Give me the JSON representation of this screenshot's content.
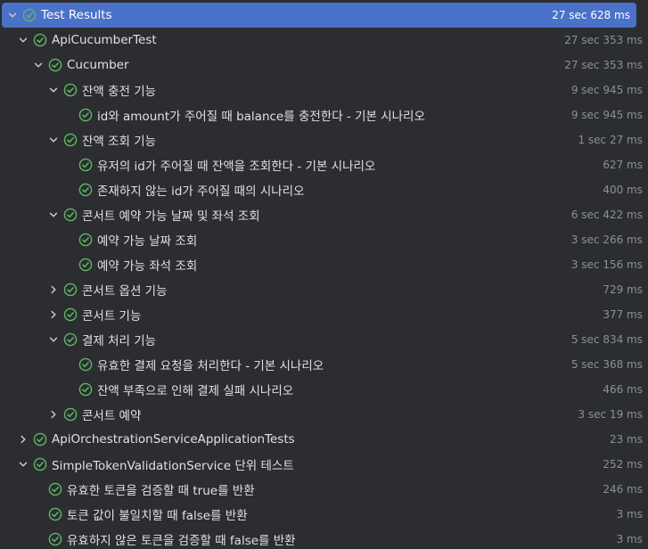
{
  "colors": {
    "background": "#2b2d30",
    "selected_row": "#4a72c8",
    "passed_icon": "#5fb865",
    "text": "#dfe1e5",
    "duration_text": "#8c9096"
  },
  "tree": {
    "rows": [
      {
        "name": "Test Results",
        "time": "27 sec 628 ms",
        "status": "passed",
        "expanded": true
      },
      {
        "name": "ApiCucumberTest",
        "time": "27 sec 353 ms",
        "status": "passed",
        "expanded": true
      },
      {
        "name": "Cucumber",
        "time": "27 sec 353 ms",
        "status": "passed",
        "expanded": true
      },
      {
        "name": "잔액 충전 기능",
        "time": "9 sec 945 ms",
        "status": "passed",
        "expanded": true
      },
      {
        "name": "id와 amount가 주어질 때 balance를 충전한다 - 기본 시나리오",
        "time": "9 sec 945 ms",
        "status": "passed"
      },
      {
        "name": "잔액 조회 기능",
        "time": "1 sec 27 ms",
        "status": "passed",
        "expanded": true
      },
      {
        "name": "유저의 id가 주어질 때 잔액을 조회한다 - 기본 시나리오",
        "time": "627 ms",
        "status": "passed"
      },
      {
        "name": "존재하지 않는 id가 주어질 때의 시나리오",
        "time": "400 ms",
        "status": "passed"
      },
      {
        "name": "콘서트 예약 가능 날짜 및 좌석 조회",
        "time": "6 sec 422 ms",
        "status": "passed",
        "expanded": true
      },
      {
        "name": "예약 가능 날짜 조회",
        "time": "3 sec 266 ms",
        "status": "passed"
      },
      {
        "name": "예약 가능 좌석 조회",
        "time": "3 sec 156 ms",
        "status": "passed"
      },
      {
        "name": "콘서트 옵션 기능",
        "time": "729 ms",
        "status": "passed",
        "expanded": false
      },
      {
        "name": "콘서트 기능",
        "time": "377 ms",
        "status": "passed",
        "expanded": false
      },
      {
        "name": "결제 처리 기능",
        "time": "5 sec 834 ms",
        "status": "passed",
        "expanded": true
      },
      {
        "name": "유효한 결제 요청을 처리한다 - 기본 시나리오",
        "time": "5 sec 368 ms",
        "status": "passed"
      },
      {
        "name": "잔액 부족으로 인해 결제 실패 시나리오",
        "time": "466 ms",
        "status": "passed"
      },
      {
        "name": "콘서트 예약",
        "time": "3 sec 19 ms",
        "status": "passed",
        "expanded": false
      },
      {
        "name": "ApiOrchestrationServiceApplicationTests",
        "time": "23 ms",
        "status": "passed",
        "expanded": false
      },
      {
        "name": "SimpleTokenValidationService 단위 테스트",
        "time": "252 ms",
        "status": "passed",
        "expanded": true
      },
      {
        "name": "유효한 토큰을 검증할 때 true를 반환",
        "time": "246 ms",
        "status": "passed"
      },
      {
        "name": "토큰 값이 불일치할 때 false를 반환",
        "time": "3 ms",
        "status": "passed"
      },
      {
        "name": "유효하지 않은 토큰을 검증할 때 false를 반환",
        "time": "3 ms",
        "status": "passed"
      }
    ]
  }
}
